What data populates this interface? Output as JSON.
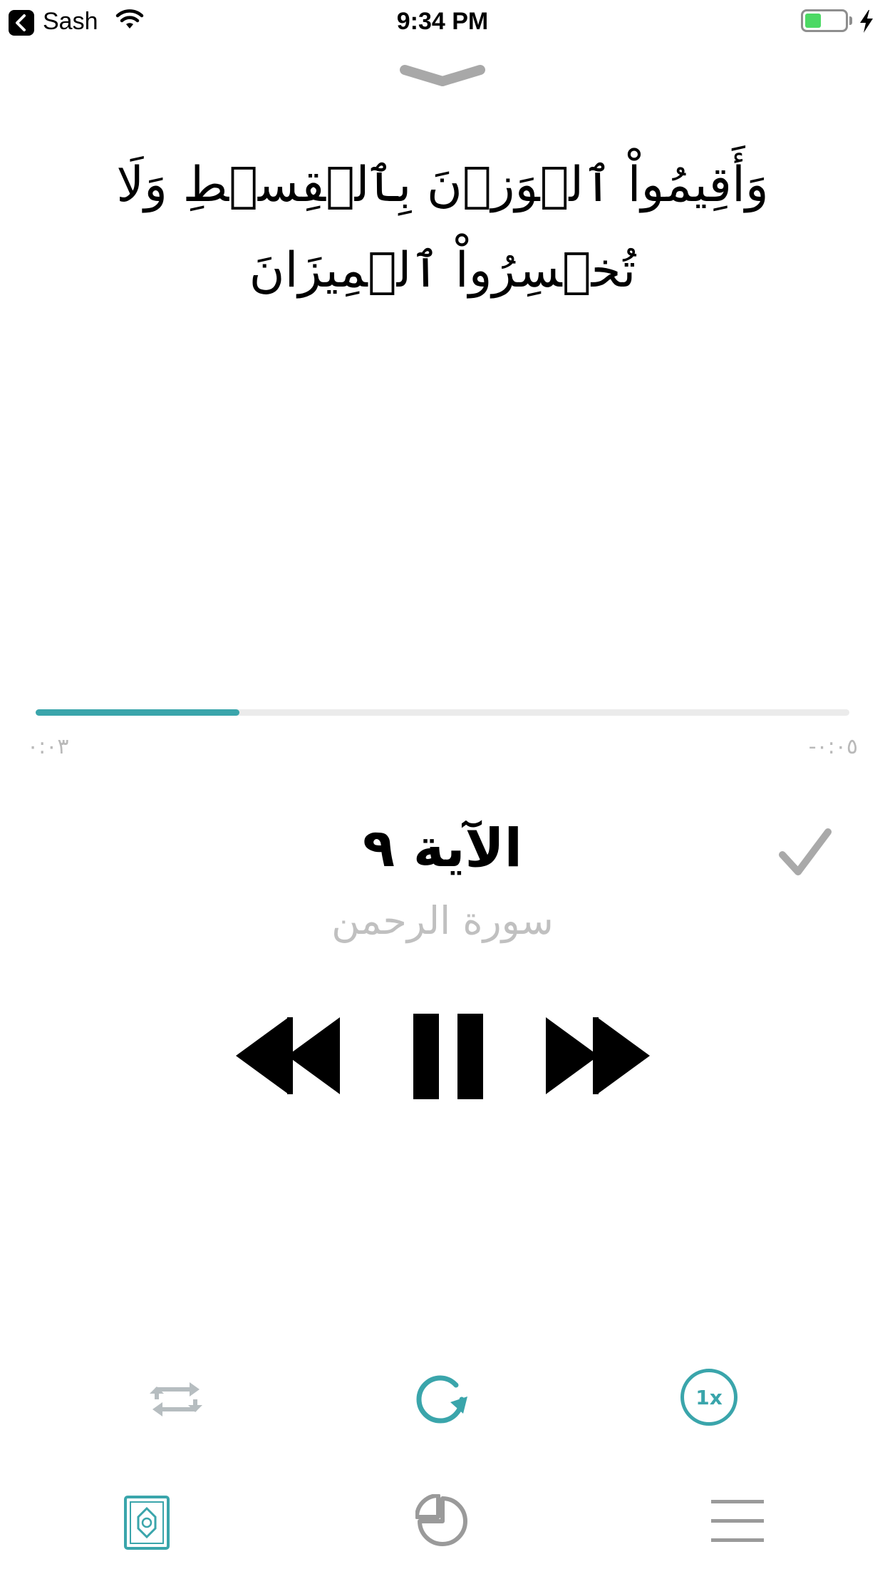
{
  "status_bar": {
    "back_app": "Sash",
    "time": "9:34 PM",
    "battery_color": "#4cd964"
  },
  "player": {
    "verse_text": "وَأَقِيمُواْ ٱلۡوَزۡنَ بِٱلۡقِسۡطِ وَلَا تُخۡسِرُواْ ٱلۡمِيزَانَ",
    "progress": 0.25,
    "time_elapsed": "٠:٠٣",
    "time_remaining": "-٠:٠٥",
    "ayah_title": "الآية ٩",
    "surah_name": "سورة الرحمن",
    "accent_color": "#3aa5ab"
  },
  "controls": {
    "speed_label": "1x"
  },
  "icons": {
    "back": "chevron-left-icon",
    "wifi": "wifi-icon",
    "dismiss": "chevron-down-icon",
    "done": "checkmark-icon",
    "rewind": "rewind-icon",
    "pause": "pause-icon",
    "forward": "fast-forward-icon",
    "repeat": "repeat-icon",
    "replay": "replay-icon",
    "tab_quran": "quran-book-icon",
    "tab_stats": "pie-chart-icon",
    "tab_menu": "menu-icon"
  }
}
